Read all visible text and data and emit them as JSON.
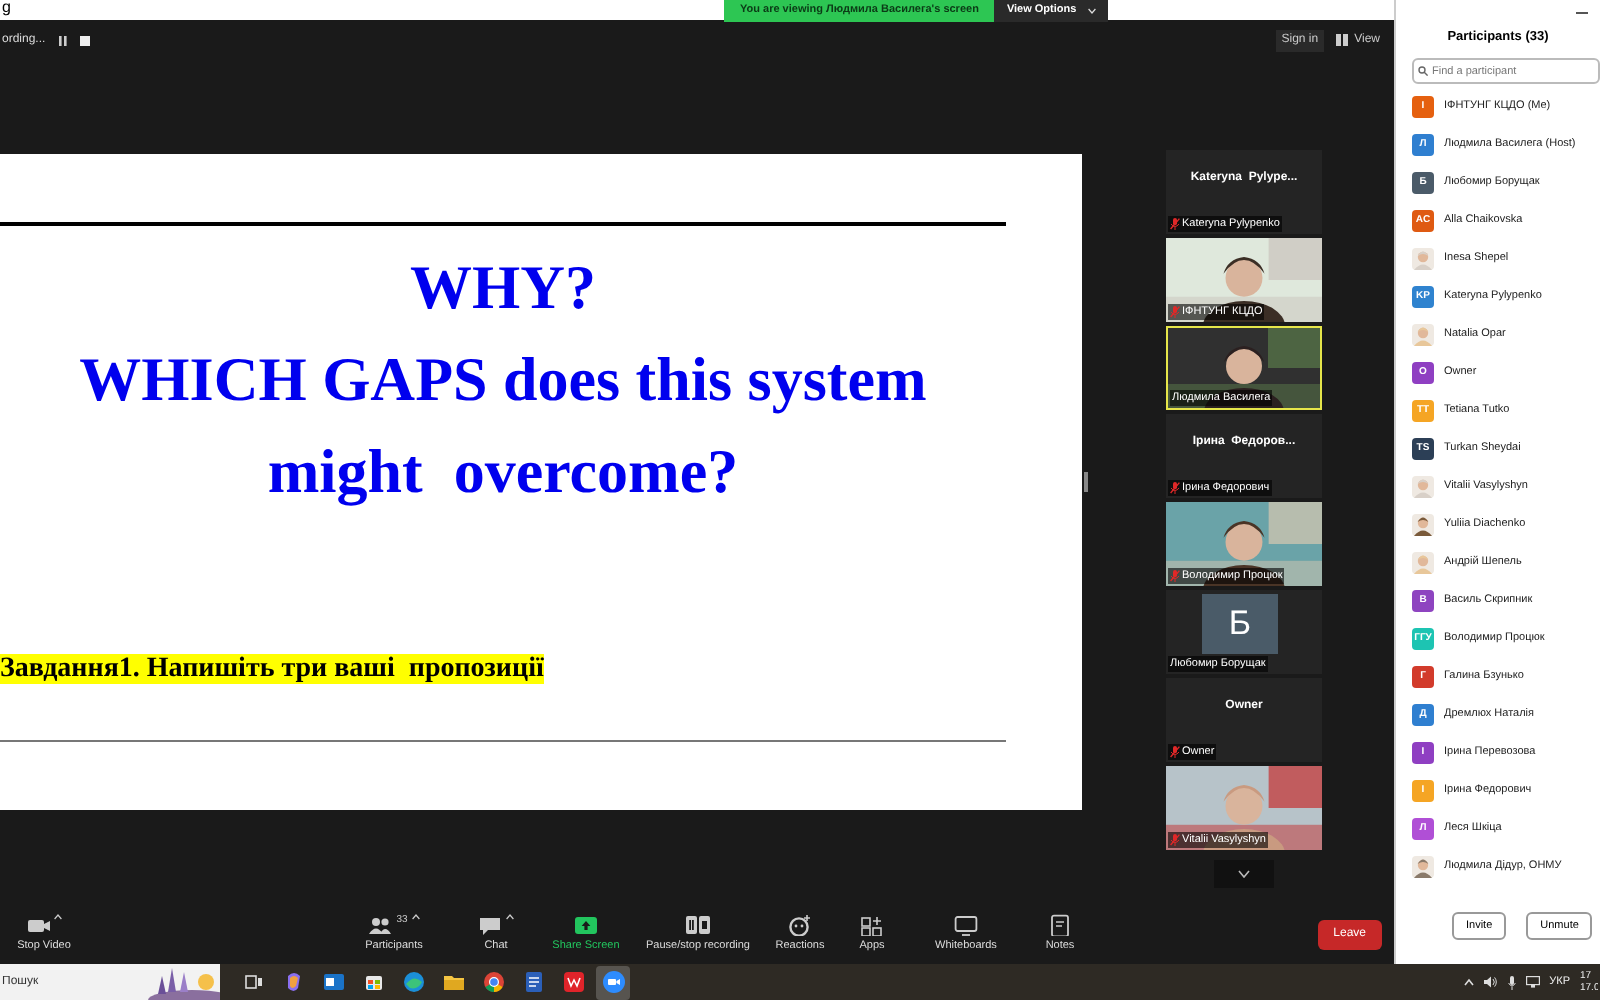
{
  "window": {
    "title": "g"
  },
  "share_banner": {
    "text": "You are viewing Людмила Василега's screen",
    "button": "View Options"
  },
  "top_bar": {
    "recording": "ording...",
    "sign_in": "Sign in",
    "view": "View"
  },
  "slide": {
    "title_lines": [
      "WHY?",
      "WHICH GAPS does this system",
      "might  overcome?"
    ],
    "task": "Завдання1. Напишіть три ваші  пропозиції"
  },
  "video_tiles": [
    {
      "kind": "name",
      "title": "Kateryna  Pylype...",
      "label": "Kateryna Pylypenko",
      "muted": true,
      "speaking": false
    },
    {
      "kind": "video",
      "label": "ІФНТУНГ КЦДО",
      "muted": true,
      "speaking": false
    },
    {
      "kind": "video",
      "label": "Людмила Василега",
      "muted": false,
      "speaking": true
    },
    {
      "kind": "name",
      "title": "Ірина  Федоров...",
      "label": "Ірина Федорович",
      "muted": true,
      "speaking": false
    },
    {
      "kind": "video",
      "label": "Володимир Процюк",
      "muted": true,
      "speaking": false
    },
    {
      "kind": "avatar",
      "initial": "Б",
      "label": "Любомир Борущак",
      "muted": false,
      "speaking": false
    },
    {
      "kind": "name",
      "title": "Owner",
      "label": "Owner",
      "muted": true,
      "speaking": false
    },
    {
      "kind": "video",
      "label": "Vitalii Vasylyshyn",
      "muted": true,
      "speaking": false
    }
  ],
  "toolbar": [
    {
      "kind": "video",
      "label": "Stop Video",
      "caret": true
    },
    {
      "kind": "participants",
      "label": "Participants",
      "count": "33",
      "caret": true
    },
    {
      "kind": "chat",
      "label": "Chat",
      "caret": true
    },
    {
      "kind": "share",
      "label": "Share Screen",
      "caret": false
    },
    {
      "kind": "record",
      "label": "Pause/stop recording",
      "caret": false
    },
    {
      "kind": "reactions",
      "label": "Reactions",
      "caret": false
    },
    {
      "kind": "apps",
      "label": "Apps",
      "caret": false
    },
    {
      "kind": "whiteboards",
      "label": "Whiteboards",
      "caret": false
    },
    {
      "kind": "notes",
      "label": "Notes",
      "caret": false
    }
  ],
  "leave_button": "Leave",
  "participants": {
    "title": "Participants (33)",
    "search_placeholder": "Find a participant",
    "items": [
      {
        "kind": "initials",
        "initials": "I",
        "color": "#e5600f",
        "name": "ІФНТУНГ КЦДО (Me)"
      },
      {
        "kind": "initials",
        "initials": "Л",
        "color": "#2f7fd0",
        "name": "Людмила Василега (Host)"
      },
      {
        "kind": "initials",
        "initials": "Б",
        "color": "#4b5b69",
        "name": "Любомир Борущак"
      },
      {
        "kind": "initials",
        "initials": "AC",
        "color": "#df5a12",
        "name": "Alla Chaikovska"
      },
      {
        "name": "Inesa Shepel"
      },
      {
        "kind": "initials",
        "initials": "KP",
        "color": "#2f83cf",
        "name": "Kateryna Pylypenko"
      },
      {
        "name": "Natalia Opar"
      },
      {
        "kind": "initials",
        "initials": "O",
        "color": "#8f3fc2",
        "name": "Owner"
      },
      {
        "kind": "initials",
        "initials": "TT",
        "color": "#f5a524",
        "name": "Tetiana Tutko"
      },
      {
        "kind": "initials",
        "initials": "TS",
        "color": "#2c3f56",
        "name": "Turkan Sheydai"
      },
      {
        "name": "Vitalii Vasylyshyn"
      },
      {
        "name": "Yuliia Diachenko"
      },
      {
        "name": "Андрій Шепель"
      },
      {
        "kind": "initials",
        "initials": "В",
        "color": "#8e44c0",
        "name": "Василь Скрипник"
      },
      {
        "kind": "initials",
        "initials": "ГГУ",
        "color": "#1dc4b2",
        "name": "Володимир Процюк"
      },
      {
        "kind": "initials",
        "initials": "Г",
        "color": "#d23b2b",
        "name": "Галина Бзунько"
      },
      {
        "kind": "initials",
        "initials": "Д",
        "color": "#2f7fd0",
        "name": "Дремлюх Наталія"
      },
      {
        "kind": "initials",
        "initials": "I",
        "color": "#8f3fc2",
        "name": "Ірина Перевозова"
      },
      {
        "kind": "initials",
        "initials": "I",
        "color": "#f5a524",
        "name": "Ірина Федорович"
      },
      {
        "kind": "initials",
        "initials": "Л",
        "color": "#b04fd6",
        "name": "Леся Шкіца"
      },
      {
        "name": "Людмила Дідур, ОНМУ"
      }
    ],
    "buttons": [
      "Invite",
      "Unmute"
    ]
  },
  "taskbar": {
    "search_placeholder": "Пошук",
    "apps": [
      {
        "kind": "taskview",
        "active": false
      },
      {
        "kind": "copilot",
        "active": false
      },
      {
        "kind": "mail",
        "active": false
      },
      {
        "kind": "store",
        "active": false
      },
      {
        "kind": "edge",
        "active": false
      },
      {
        "kind": "folder",
        "active": false
      },
      {
        "kind": "chrome",
        "active": false
      },
      {
        "kind": "doc",
        "active": false
      },
      {
        "kind": "wps",
        "active": false
      },
      {
        "kind": "zoom",
        "active": true
      }
    ],
    "language": "УКР",
    "clock": [
      "17",
      "17.0"
    ]
  }
}
